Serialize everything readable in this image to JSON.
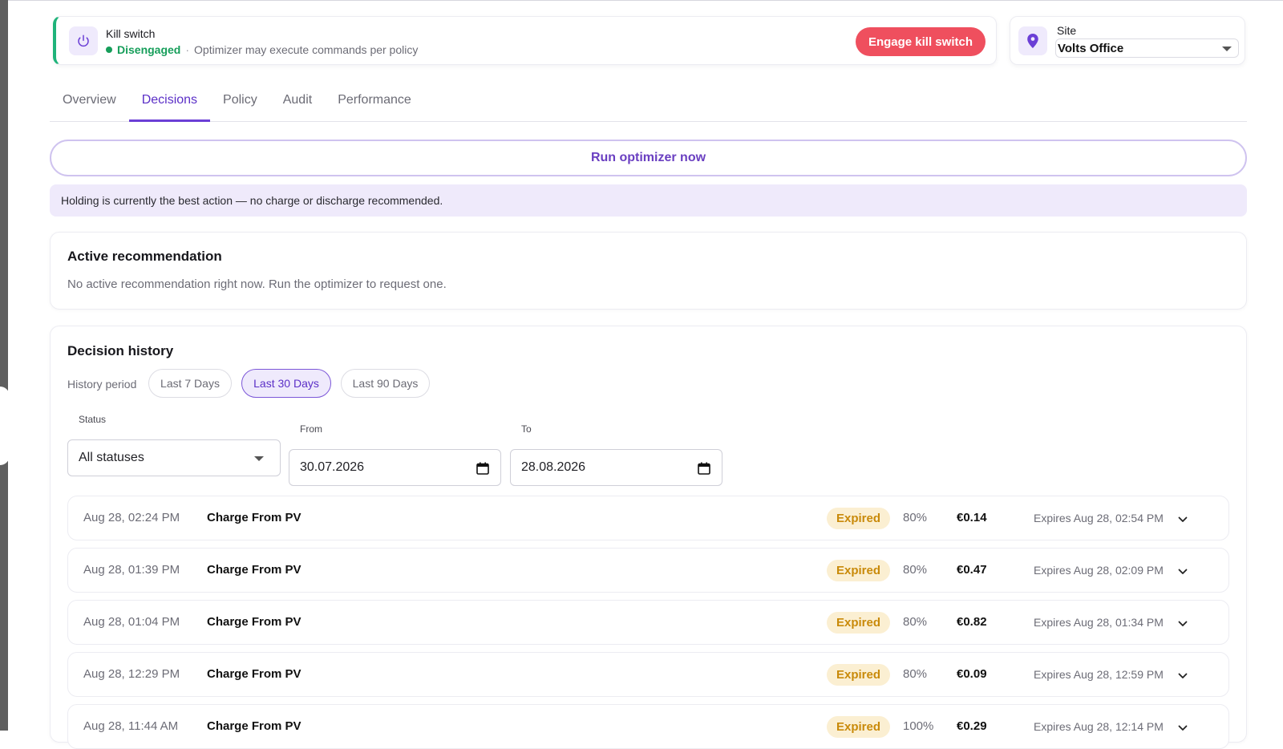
{
  "kill_switch": {
    "title": "Kill switch",
    "status": "Disengaged",
    "separator": "·",
    "detail": "Optimizer may execute commands per policy",
    "engage_label": "Engage kill switch",
    "icon": "power-icon"
  },
  "site": {
    "label": "Site",
    "selected": "Volts Office",
    "icon": "location-pin-icon"
  },
  "tabs": [
    {
      "label": "Overview",
      "active": false
    },
    {
      "label": "Decisions",
      "active": true
    },
    {
      "label": "Policy",
      "active": false
    },
    {
      "label": "Audit",
      "active": false
    },
    {
      "label": "Performance",
      "active": false
    }
  ],
  "run_optimizer_label": "Run optimizer now",
  "info_banner": "Holding is currently the best action — no charge or discharge recommended.",
  "active_recommendation": {
    "title": "Active recommendation",
    "text": "No active recommendation right now. Run the optimizer to request one."
  },
  "history": {
    "title": "Decision history",
    "period_label": "History period",
    "periods": [
      {
        "label": "Last 7 Days",
        "active": false
      },
      {
        "label": "Last 30 Days",
        "active": true
      },
      {
        "label": "Last 90 Days",
        "active": false
      }
    ],
    "status_label": "Status",
    "status_value": "All statuses",
    "from_label": "From",
    "from_value": "30.07.2026",
    "to_label": "To",
    "to_value": "28.08.2026",
    "rows": [
      {
        "time": "Aug 28, 02:24 PM",
        "action": "Charge From PV",
        "status": "Expired",
        "confidence": "80%",
        "value": "€0.14",
        "expires": "Expires Aug 28, 02:54 PM"
      },
      {
        "time": "Aug 28, 01:39 PM",
        "action": "Charge From PV",
        "status": "Expired",
        "confidence": "80%",
        "value": "€0.47",
        "expires": "Expires Aug 28, 02:09 PM"
      },
      {
        "time": "Aug 28, 01:04 PM",
        "action": "Charge From PV",
        "status": "Expired",
        "confidence": "80%",
        "value": "€0.82",
        "expires": "Expires Aug 28, 01:34 PM"
      },
      {
        "time": "Aug 28, 12:29 PM",
        "action": "Charge From PV",
        "status": "Expired",
        "confidence": "80%",
        "value": "€0.09",
        "expires": "Expires Aug 28, 12:59 PM"
      },
      {
        "time": "Aug 28, 11:44 AM",
        "action": "Charge From PV",
        "status": "Expired",
        "confidence": "100%",
        "value": "€0.29",
        "expires": "Expires Aug 28, 12:14 PM"
      }
    ]
  },
  "colors": {
    "accent": "#6b3fd6",
    "danger": "#ef4f5e",
    "success": "#169e5a",
    "expired_badge_bg": "#fbefd2",
    "expired_badge_text": "#c98a0a"
  }
}
